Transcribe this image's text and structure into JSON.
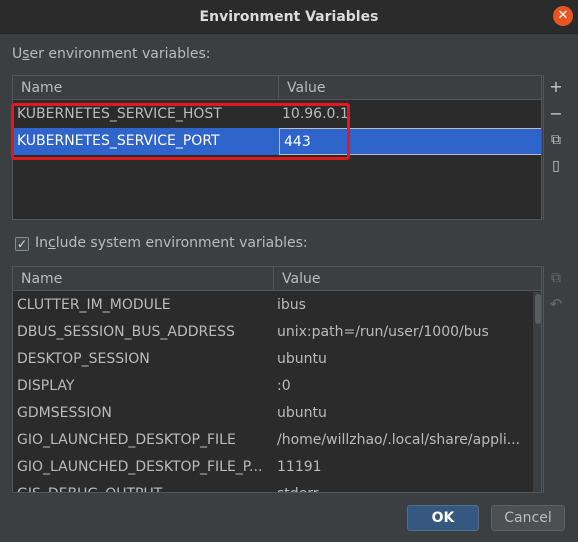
{
  "window": {
    "title": "Environment Variables",
    "close_glyph": "✕"
  },
  "user_env": {
    "label_prefix": "U",
    "label_mnemonic": "s",
    "label_rest": "er environment variables:",
    "columns": [
      "Name",
      "Value"
    ],
    "rows": [
      {
        "name": "KUBERNETES_SERVICE_HOST",
        "value": "10.96.0.1"
      },
      {
        "name": "KUBERNETES_SERVICE_PORT",
        "value": "443"
      }
    ],
    "toolbar": {
      "add_glyph": "+",
      "remove_glyph": "−",
      "copy_glyph": "⧉",
      "paste_glyph": "▯"
    }
  },
  "system_env": {
    "checkbox_checked": true,
    "check_glyph": "✓",
    "label_prefix": "In",
    "label_mnemonic": "c",
    "label_rest": "lude system environment variables:",
    "columns": [
      "Name",
      "Value"
    ],
    "rows": [
      {
        "name": "CLUTTER_IM_MODULE",
        "value": "ibus"
      },
      {
        "name": "DBUS_SESSION_BUS_ADDRESS",
        "value": "unix:path=/run/user/1000/bus"
      },
      {
        "name": "DESKTOP_SESSION",
        "value": "ubuntu"
      },
      {
        "name": "DISPLAY",
        "value": ":0"
      },
      {
        "name": "GDMSESSION",
        "value": "ubuntu"
      },
      {
        "name": "GIO_LAUNCHED_DESKTOP_FILE",
        "value": "/home/willzhao/.local/share/appli..."
      },
      {
        "name": "GIO_LAUNCHED_DESKTOP_FILE_P...",
        "value": "11191"
      },
      {
        "name": "GJS_DEBUG_OUTPUT",
        "value": "stderr"
      }
    ],
    "toolbar": {
      "copy_glyph": "⧉",
      "revert_glyph": "↶"
    }
  },
  "buttons": {
    "ok": "OK",
    "cancel": "Cancel"
  },
  "colors": {
    "background": "#3c3f41",
    "table_background": "#2b2b2b",
    "selection": "#2f65ca",
    "highlight_box": "#e0191d",
    "close_button": "#e95420"
  }
}
